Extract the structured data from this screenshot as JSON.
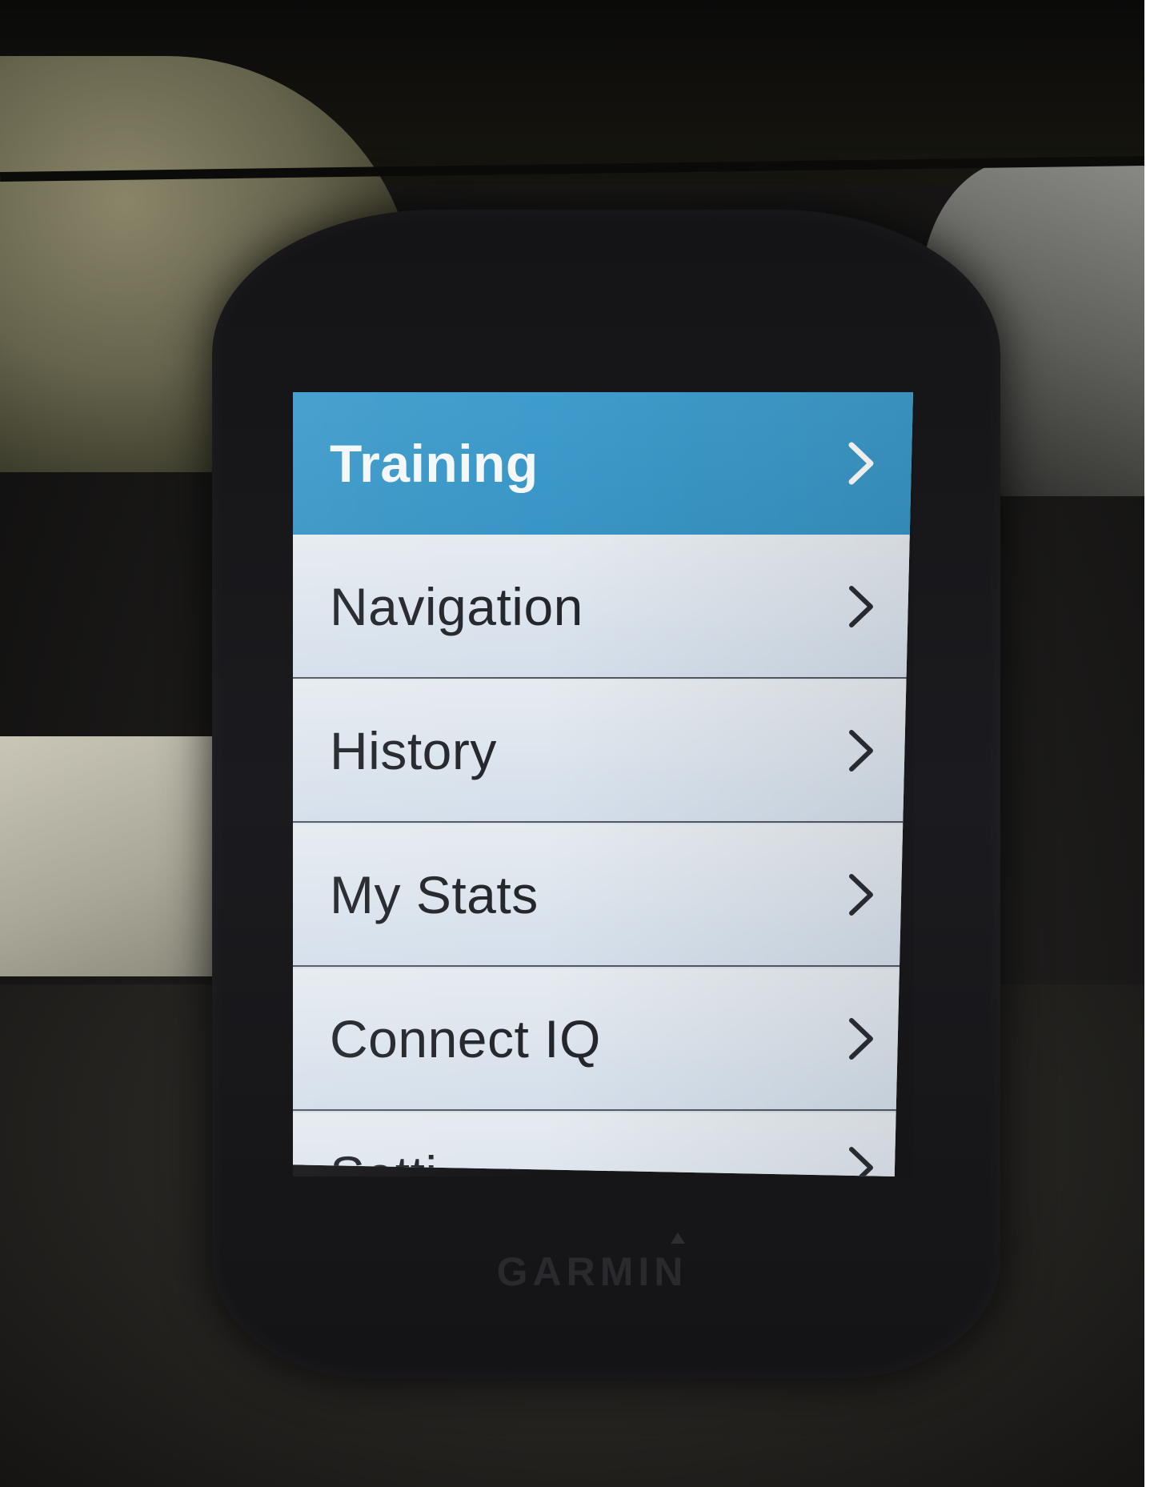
{
  "menu": {
    "items": [
      {
        "label": "Training",
        "selected": true
      },
      {
        "label": "Navigation",
        "selected": false
      },
      {
        "label": "History",
        "selected": false
      },
      {
        "label": "My Stats",
        "selected": false
      },
      {
        "label": "Connect IQ",
        "selected": false
      },
      {
        "label": "Setti",
        "selected": false
      }
    ],
    "chevron_icon": "chevron-right-icon"
  },
  "device": {
    "brand": "GARMIN"
  },
  "colors": {
    "selected_background": "#3f9ccc",
    "item_background": "#dfe6ee",
    "divider": "#55595f",
    "text": "#23262b"
  }
}
